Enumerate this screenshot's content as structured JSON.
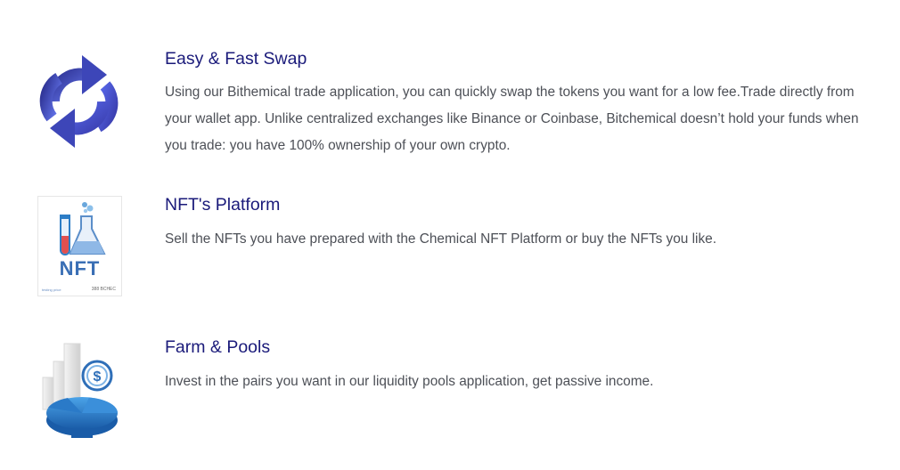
{
  "features": [
    {
      "title": "Easy & Fast Swap",
      "description": "Using our Bithemical trade application, you can quickly swap the tokens you want for a low fee.Trade directly from your wallet app. Unlike centralized exchanges like Binance or Coinbase, Bitchemical doesn’t hold your funds when you trade: you have 100% ownership of your own crypto.",
      "icon": "swap-arrows-icon"
    },
    {
      "title": "NFT's Platform",
      "description": "Sell the NFTs you have prepared with the Chemical NFT Platform or buy the NFTs you like.",
      "icon": "nft-flask-icon",
      "card": {
        "label": "NFT",
        "foot_left": "testing price",
        "foot_right": "388 BCHEC"
      }
    },
    {
      "title": "Farm & Pools",
      "description": "Invest in the pairs you want in our liquidity pools application, get passive income.",
      "icon": "farm-pools-icon"
    }
  ],
  "colors": {
    "title": "#1a1a7a",
    "text": "#4d5057",
    "accent_blue": "#4a5ae8",
    "nft_blue": "#3a6fb5"
  }
}
